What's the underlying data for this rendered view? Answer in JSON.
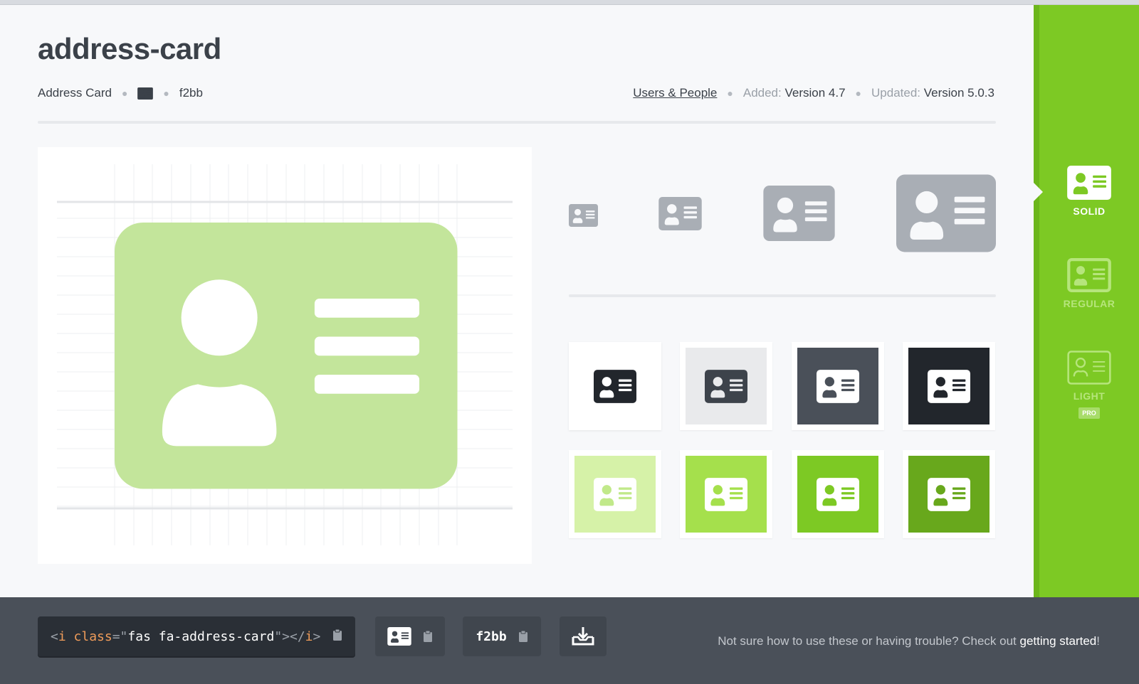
{
  "icon": {
    "name": "address-card",
    "label": "Address Card",
    "unicode": "f2bb",
    "category": "Users & People",
    "added_label": "Added:",
    "added_version": "Version 4.7",
    "updated_label": "Updated:",
    "updated_version": "Version 5.0.3"
  },
  "styles": [
    {
      "label": "SOLID",
      "active": true
    },
    {
      "label": "REGULAR",
      "active": false
    },
    {
      "label": "LIGHT",
      "active": false,
      "badge": "PRO"
    }
  ],
  "swatches": [
    {
      "bg": "#ffffff",
      "card": "#22262c",
      "glyph": "#ffffff"
    },
    {
      "bg": "#e9eaec",
      "card": "#3d434b",
      "glyph": "#e9eaec"
    },
    {
      "bg": "#4a5059",
      "card": "#ffffff",
      "glyph": "#4a5059"
    },
    {
      "bg": "#22262c",
      "card": "#ffffff",
      "glyph": "#22262c"
    },
    {
      "bg": "#d6f2a8",
      "card": "#ffffff",
      "glyph": "#c1e98a"
    },
    {
      "bg": "#a5e04c",
      "card": "#ffffff",
      "glyph": "#a5e04c"
    },
    {
      "bg": "#7dc924",
      "card": "#ffffff",
      "glyph": "#7dc924"
    },
    {
      "bg": "#68a81c",
      "card": "#ffffff",
      "glyph": "#68a81c"
    }
  ],
  "footer": {
    "code": {
      "open": "<",
      "tag": "i",
      "attr": "class",
      "eq": "=\"",
      "value": "fas fa-address-card",
      "close": "\"></",
      "tag_end": "i",
      "gt": ">"
    },
    "unicode": "f2bb",
    "help_text": "Not sure how to use these or having trouble? Check out ",
    "help_link": "getting started",
    "help_end": "!"
  },
  "colors": {
    "brand_green": "#7dc924",
    "text_dark": "#3b4149",
    "preview_green": "#c3e59b",
    "size_gray": "#a9aeb5"
  },
  "icons": [
    "address-card-icon",
    "clipboard-icon",
    "download-icon"
  ]
}
